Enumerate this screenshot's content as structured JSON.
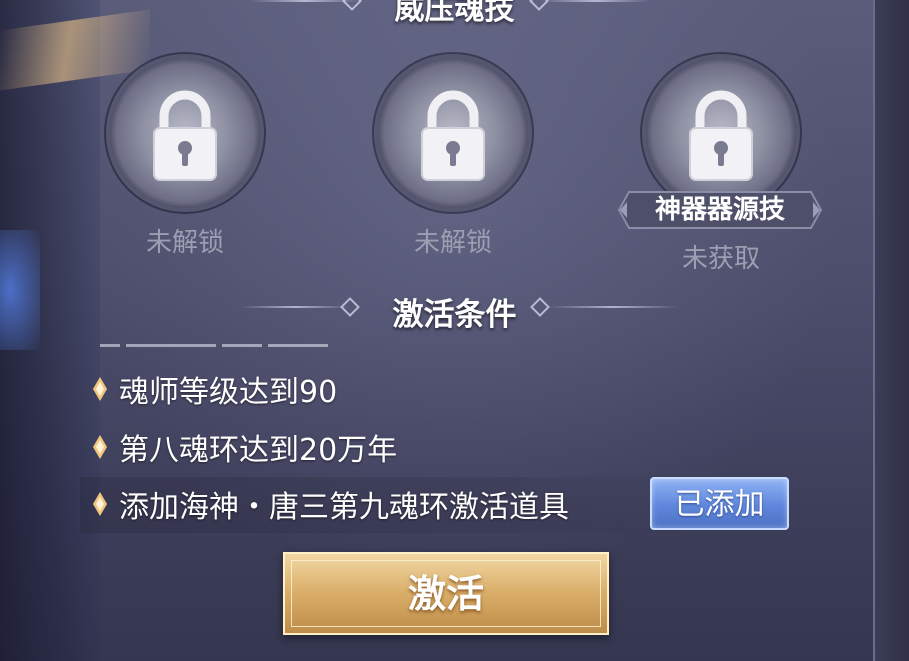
{
  "panel": {
    "title": "威压魂技"
  },
  "skills": [
    {
      "status": "未解锁"
    },
    {
      "status": "未解锁"
    },
    {
      "tag": "神器器源技",
      "status": "未获取"
    }
  ],
  "conditions": {
    "header": "激活条件",
    "items": [
      {
        "text": "魂师等级达到90"
      },
      {
        "text": "第八魂环达到20万年"
      },
      {
        "text": "添加海神・唐三第九魂环激活道具",
        "action_label": "已添加"
      }
    ]
  },
  "activate_button": {
    "label": "激活"
  },
  "colors": {
    "accent_gold": "#d9ad68",
    "added_blue": "#5f86dc"
  }
}
